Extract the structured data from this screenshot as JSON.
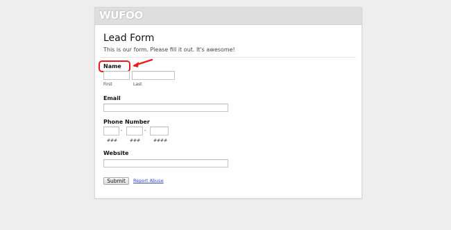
{
  "brand": {
    "logo_text": "WUFOO"
  },
  "form": {
    "title": "Lead Form",
    "description": "This is our form. Please fill it out. It's awesome!"
  },
  "fields": {
    "name": {
      "label": "Name",
      "first_sublabel": "First",
      "last_sublabel": "Last",
      "first_value": "",
      "last_value": ""
    },
    "email": {
      "label": "Email",
      "value": ""
    },
    "phone": {
      "label": "Phone Number",
      "separator": "-",
      "part1_hint": "###",
      "part2_hint": "###",
      "part3_hint": "####"
    },
    "website": {
      "label": "Website",
      "value": ""
    }
  },
  "actions": {
    "submit_label": "Submit",
    "report_label": "Report Abuse"
  },
  "colors": {
    "highlight": "#ee1a1a",
    "link": "#3344cc",
    "page_bg": "#eeeeee",
    "logo_bar": "#dedede"
  }
}
